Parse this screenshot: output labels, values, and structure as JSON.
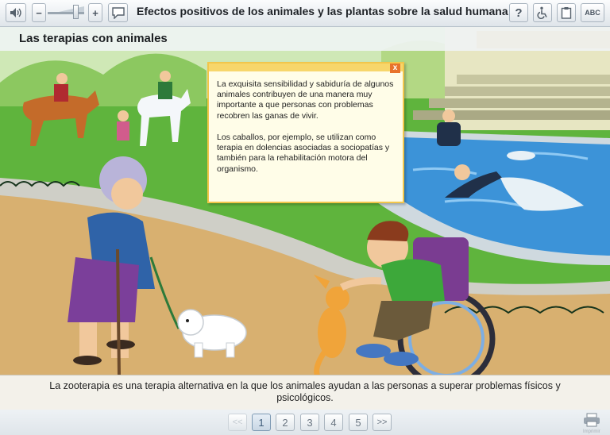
{
  "header": {
    "title": "Efectos positivos de los animales y las plantas sobre la salud humana",
    "audio_icon": "speaker-icon",
    "minus_label": "−",
    "plus_label": "+",
    "volume_level": 0.75,
    "speech_icon": "speech-bubble-icon",
    "help_label": "?",
    "accessibility_icon": "wheelchair-icon",
    "clipboard_icon": "clipboard-icon",
    "abc_label": "ABC"
  },
  "section": {
    "title": "Las terapias con animales"
  },
  "popup": {
    "close_label": "x",
    "paragraph1": "La exquisita sensibilidad y sabiduría de algunos animales contribuyen de una manera muy importante a que personas con problemas recobren las ganas de vivir.",
    "paragraph2": "Los caballos, por ejemplo, se utilizan como terapia en dolencias asociadas a sociopatías y también para la rehabilitación motora del organismo."
  },
  "caption": {
    "text": "La zooterapia es una terapia alternativa en la que los animales ayudan a las personas a superar problemas físicos y psicológicos."
  },
  "pager": {
    "prev_label": "<<",
    "pages": [
      "1",
      "2",
      "3",
      "4",
      "5"
    ],
    "current_page": "1",
    "next_label": ">>"
  },
  "footer": {
    "print_icon": "printer-icon",
    "print_caption": "Imprimir"
  }
}
